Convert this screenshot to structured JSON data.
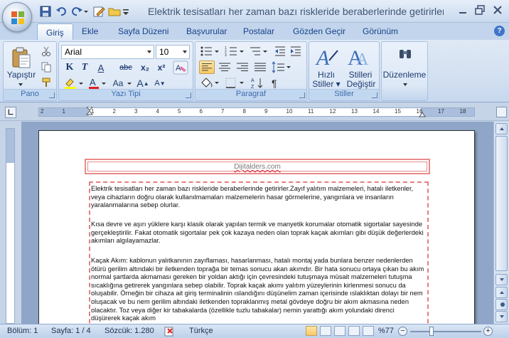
{
  "window": {
    "title": "Elektrik tesisatları her zaman bazı riskleride beraberlerinde getirirler - M"
  },
  "tabs": [
    "Giriş",
    "Ekle",
    "Sayfa Düzeni",
    "Başvurular",
    "Postalar",
    "Gözden Geçir",
    "Görünüm"
  ],
  "active_tab": "Giriş",
  "ribbon": {
    "clipboard": {
      "paste_label": "Yapıştır",
      "group": "Pano"
    },
    "font": {
      "font_name": "Arial",
      "font_size": "10",
      "bold": "K",
      "italic": "T",
      "underline": "A",
      "strike": "abc",
      "subscript": "x₂",
      "superscript": "x²",
      "grow": "A",
      "shrink": "A",
      "case": "Aa",
      "group": "Yazı Tipi"
    },
    "paragraph": {
      "group": "Paragraf"
    },
    "styles": {
      "quick_label_1": "Hızlı",
      "quick_label_2": "Stiller",
      "change_label_1": "Stilleri",
      "change_label_2": "Değiştir",
      "group": "Stiller"
    },
    "editing": {
      "label": "Düzenleme"
    }
  },
  "ruler": {
    "numbers": [
      "2",
      "1",
      "1",
      "2",
      "3",
      "4",
      "5",
      "6",
      "7",
      "8",
      "9",
      "10",
      "11",
      "12",
      "13",
      "14",
      "15",
      "16",
      "17",
      "18"
    ]
  },
  "document": {
    "header_text": "Dijitalders.com",
    "paragraphs": [
      "Elektrik tesisatları her zaman bazı riskleride beraberlerinde getirirler.Zayıf yalıtım malzemeleri, hatalı iletkenler, veya cihazların doğru olarak kullanılmamaları malzemelerin hasar görmelerine, yangınlara ve insanların yaralanmalarına sebep olurlar.",
      "Kısa devre ve aşırı yüklere karşı klasik olarak yapılan termik ve manyetik korumalar otomatik sigortalar sayesinde gerçekleştirilir. Fakat otomatik sigortalar pek çok kazaya neden olan toprak kaçak akımları gibi düşük değerlerdeki akımları algılayamazlar.",
      "Kaçak Akım: kablonun yalıtkanının zayıflaması, hasarlanması, hatalı montaj yada bunlara benzer nedenlerden ötürü gerilim altındaki bir iletkenden toprağa bir temas sonucu akan akımdır. Bir hata sonucu ortaya çıkan bu akım normal şartlarda akmaması gereken bir yoldan aktığı için çevresindeki tutuşmaya müsait malzemeleri tutuşma sıcaklığına getirerek yangınlara sebep olabilir. Toprak kaçak akımı yalıtım yüzeylerinin kirlenmesi sonucu da oluşabilir. Örneğin bir cihaza ait giriş terminalinin ıslandığını düşünelim zaman içerisinde ıslaklıktan dolayı bir nem oluşacak ve bu nem gerilim altındaki iletkenden topraklanmış metal gövdeye doğru bir akım akmasına neden olacaktır. Toz veya diğer kir tabakalarda (özellikle tuzlu tabakalar) nemin yarattığı akım yolundaki direnci düşürerek kaçak akım"
    ]
  },
  "status": {
    "section": "Bölüm: 1",
    "page": "Sayfa: 1 / 4",
    "words": "Sözcük: 1.280",
    "language": "Türkçe",
    "zoom": "%77"
  }
}
